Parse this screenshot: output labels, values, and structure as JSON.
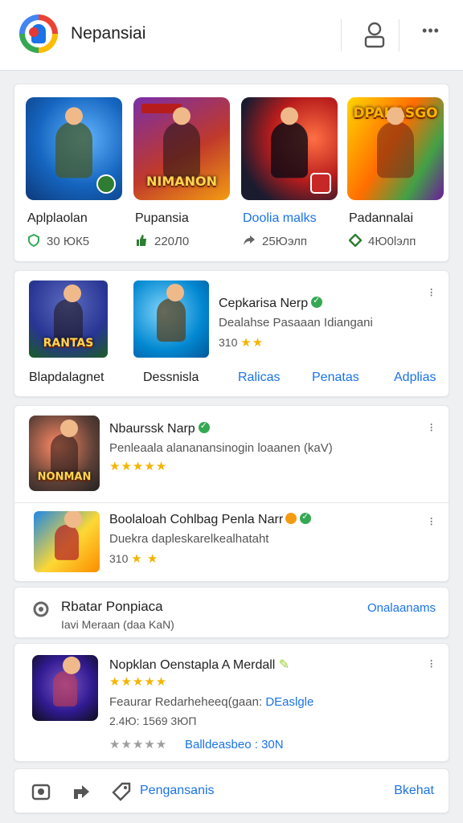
{
  "header": {
    "app_title": "Nepansiai"
  },
  "featured": {
    "tiles": [
      {
        "name": "Aplplaolan",
        "stat": "30 ЮК5",
        "art_label": "",
        "stat_icon": "shield-check-icon"
      },
      {
        "name": "Pupansia",
        "stat": "220Л0",
        "art_label": "NIMANON",
        "stat_icon": "thumbs-up-icon"
      },
      {
        "name": "Doolia malks",
        "stat": "25Юэлп",
        "art_label": "",
        "stat_icon": "share-icon"
      },
      {
        "name": "Padannalai",
        "stat": "4Ю0lэлп",
        "art_label": "DPAKASGO",
        "stat_icon": "diamond-icon"
      }
    ]
  },
  "spotlight": {
    "left_name": "Blapdalagnet",
    "left_art_label": "RANTAS",
    "center_name": "Dessnisla",
    "app_title": "Cepkarisa Nerp",
    "app_desc": "Dealahse Pasaaan Idiangani",
    "app_rating": "310",
    "links": [
      "Ralicas",
      "Penatas",
      "Adplias"
    ]
  },
  "list": [
    {
      "title": "Nbaurssk Narp",
      "desc": "Penleaala alananansinogin loaanen (kaV)",
      "stars": "★★★★★",
      "art_label": "NONMAN"
    },
    {
      "title": "Boolaloah Cohlbag Penla Narr",
      "desc": "Duekra dapleskarelkealhataht",
      "rating": "310",
      "stars": "★ ★"
    }
  ],
  "news": {
    "title": "Rbatar Ponpiaca",
    "sub": "Iavi Meraan (daa KaN)",
    "action": "Onalaanams"
  },
  "featured_app": {
    "title": "Nopklan Oenstapla A Merdall",
    "stars": "★★★★★",
    "desc_prefix": "Feaurar Redarheheeq(gaan:",
    "desc_link": "DEaslgle",
    "meta": "2.4Ю: 1569 3ЮП",
    "grey_stars": "★★★★★",
    "status": "Balldeasbeo : 30N"
  },
  "bottom_bar": {
    "action_label": "Pengansanis",
    "right_label": "Bkehat"
  },
  "colors": {
    "accent": "#1a73e8",
    "verified": "#34a853",
    "star": "#f4b400"
  }
}
